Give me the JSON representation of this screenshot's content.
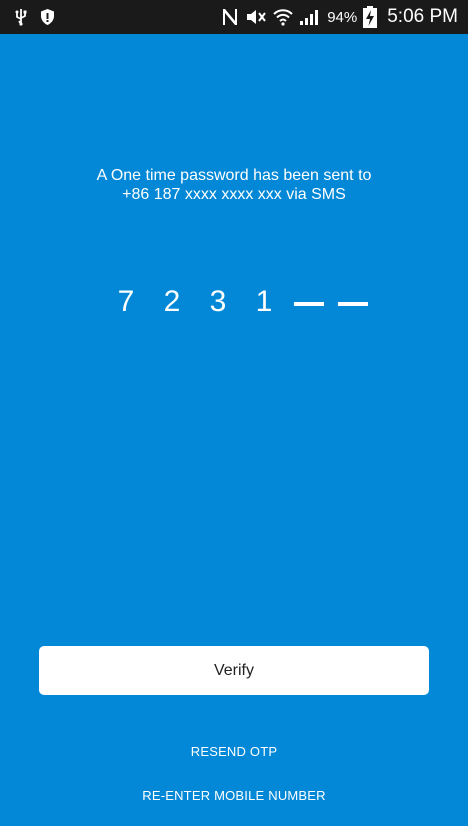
{
  "status_bar": {
    "icons": [
      "usb-icon",
      "shield-icon",
      "nfc-icon",
      "mute-icon",
      "wifi-icon",
      "signal-icon",
      "battery-charging-icon"
    ],
    "battery_percent": "94%",
    "time": "5:06 PM"
  },
  "message": {
    "line1": "A One time password has been sent to",
    "line2": "+86 187 xxxx xxxx xxx via SMS"
  },
  "otp": {
    "digits": [
      "7",
      "2",
      "3",
      "1"
    ],
    "empty_slots": 2
  },
  "actions": {
    "verify_label": "Verify",
    "resend_label": "RESEND OTP",
    "reenter_label": "RE-ENTER MOBILE NUMBER"
  },
  "colors": {
    "background": "#0288d6",
    "status_bar": "#1a1a1a",
    "button": "#ffffff"
  }
}
